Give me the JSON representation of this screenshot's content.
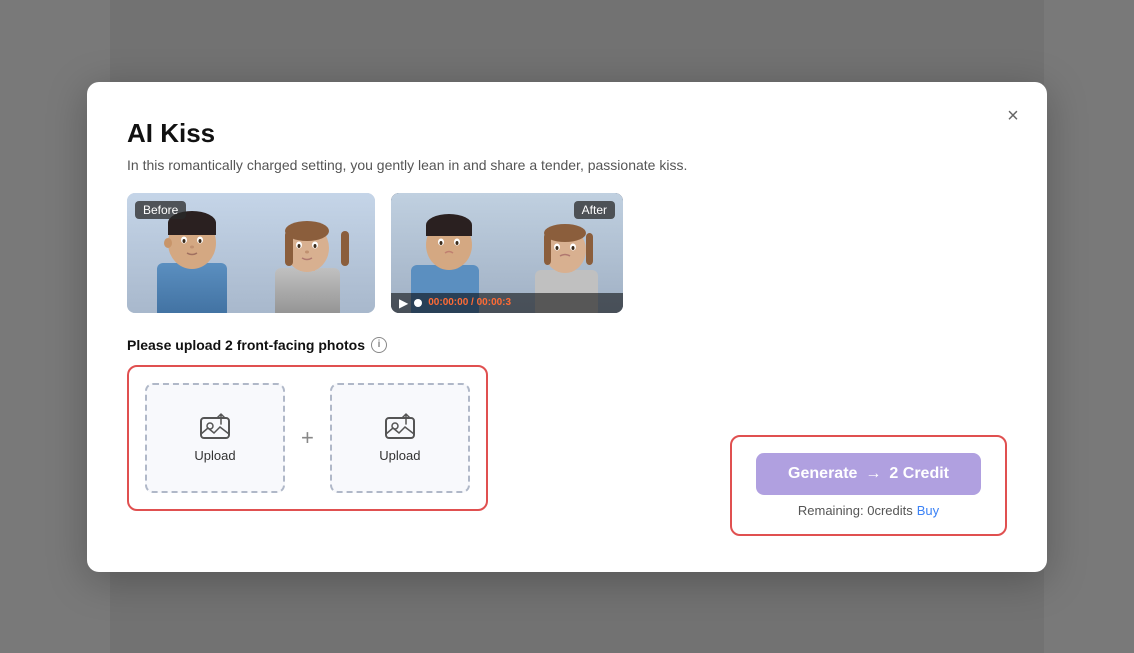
{
  "modal": {
    "title": "AI Kiss",
    "description": "In this romantically charged setting, you gently lean in and share a tender, passionate kiss.",
    "close_label": "×",
    "before_label": "Before",
    "after_label": "After",
    "video_time": "00:00:00",
    "video_duration": "00:00:3",
    "upload_section_label": "Please upload 2 front-facing photos",
    "upload_label": "Upload",
    "generate_btn_label": "Generate",
    "generate_credit": "2 Credit",
    "remaining_label": "Remaining: 0credits",
    "buy_label": "Buy"
  }
}
